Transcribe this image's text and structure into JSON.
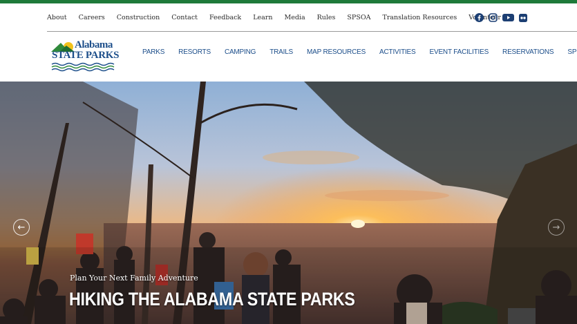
{
  "utility_nav": {
    "links": [
      {
        "label": "About"
      },
      {
        "label": "Careers"
      },
      {
        "label": "Construction"
      },
      {
        "label": "Contact"
      },
      {
        "label": "Feedback"
      },
      {
        "label": "Learn"
      },
      {
        "label": "Media"
      },
      {
        "label": "Rules"
      },
      {
        "label": "SPSOA"
      },
      {
        "label": "Translation Resources"
      },
      {
        "label": "Volunteer"
      }
    ],
    "social_icons": [
      "facebook-icon",
      "instagram-icon",
      "youtube-icon",
      "flickr-icon"
    ]
  },
  "logo": {
    "line1": "Alabama",
    "line2": "STATE PARKS"
  },
  "main_nav": {
    "items": [
      {
        "label": "PARKS"
      },
      {
        "label": "RESORTS"
      },
      {
        "label": "CAMPING"
      },
      {
        "label": "TRAILS"
      },
      {
        "label": "MAP RESOURCES"
      },
      {
        "label": "ACTIVITIES"
      },
      {
        "label": "EVENT FACILITIES"
      },
      {
        "label": "RESERVATIONS"
      },
      {
        "label": "SPECIALS"
      }
    ]
  },
  "hero": {
    "subtitle": "Plan Your Next Family Adventure",
    "title": "HIKING THE ALABAMA STATE PARKS",
    "prev_icon": "arrow-left-icon",
    "next_icon": "arrow-right-icon"
  },
  "colors": {
    "brand_green": "#1f7a3a",
    "brand_blue": "#1c4e8a",
    "text_dark": "#2b2b2b"
  }
}
